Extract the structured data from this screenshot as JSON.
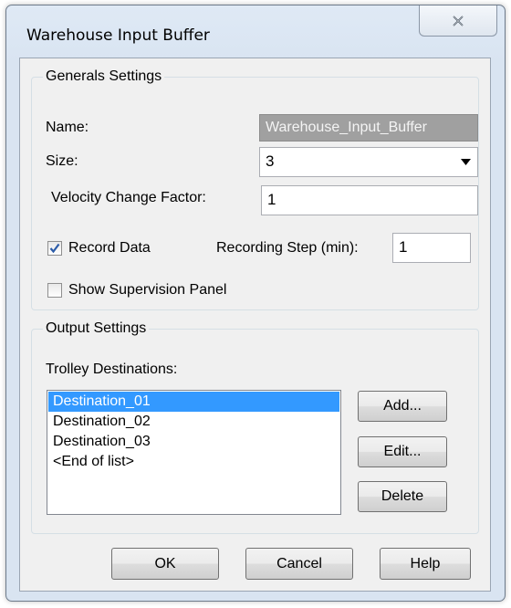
{
  "window": {
    "title": "Warehouse Input Buffer"
  },
  "general_settings": {
    "legend": "Generals Settings",
    "name_label": "Name:",
    "name_value": "Warehouse_Input_Buffer",
    "size_label": "Size:",
    "size_value": "3",
    "velocity_label": "Velocity Change Factor:",
    "velocity_value": "1",
    "record_data_label": "Record Data",
    "record_data_checked": true,
    "recording_step_label": "Recording Step (min):",
    "recording_step_value": "1",
    "show_supervision_label": "Show Supervision Panel",
    "show_supervision_checked": false
  },
  "output_settings": {
    "legend": "Output Settings",
    "destinations_label": "Trolley Destinations:",
    "destinations": [
      {
        "label": "Destination_01",
        "selected": true
      },
      {
        "label": "Destination_02",
        "selected": false
      },
      {
        "label": "Destination_03",
        "selected": false
      },
      {
        "label": "<End of list>",
        "selected": false
      }
    ],
    "add_label": "Add...",
    "edit_label": "Edit...",
    "delete_label": "Delete"
  },
  "footer": {
    "ok_label": "OK",
    "cancel_label": "Cancel",
    "help_label": "Help"
  },
  "colors": {
    "selection": "#3399ff",
    "dialog_bg": "#f0f0f0",
    "frame": "#dbe6f3"
  },
  "icons": {
    "close": "close-icon",
    "dropdown": "chevron-down-icon",
    "check": "checkmark-icon"
  }
}
